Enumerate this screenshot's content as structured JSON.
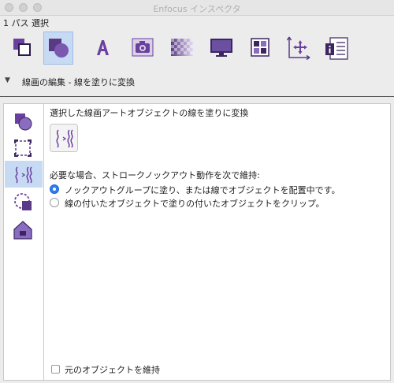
{
  "window": {
    "title": "Enfocus インスペクタ"
  },
  "selection": {
    "info": "1 パス 選択"
  },
  "toolbar": {
    "tabs": [
      {
        "icon": "path-object-icon",
        "active": false
      },
      {
        "icon": "shape-fill-icon",
        "active": true
      },
      {
        "icon": "text-icon",
        "active": false
      },
      {
        "icon": "image-icon",
        "active": false
      },
      {
        "icon": "transparency-icon",
        "active": false
      },
      {
        "icon": "display-icon",
        "active": false
      },
      {
        "icon": "grid-icon",
        "active": false
      },
      {
        "icon": "move-axes-icon",
        "active": false
      },
      {
        "icon": "info-list-icon",
        "active": false
      }
    ]
  },
  "section": {
    "title": "線画の編集 - 線を塗りに変換"
  },
  "sidebar": {
    "items": [
      {
        "icon": "shape-edit-icon",
        "active": false
      },
      {
        "icon": "bounding-box-icon",
        "active": false
      },
      {
        "icon": "stroke-to-fill-icon",
        "active": true
      },
      {
        "icon": "dashed-shape-icon",
        "active": false
      },
      {
        "icon": "house-shape-icon",
        "active": false
      }
    ]
  },
  "main": {
    "heading": "選択した線画アートオブジェクトの線を塗りに変換",
    "knockout_label": "必要な場合、ストロークノックアウト動作を次で維持:",
    "options": [
      {
        "label": "ノックアウトグループに塗り、または線でオブジェクトを配置中です。",
        "selected": true
      },
      {
        "label": "線の付いたオブジェクトで塗りの付いたオブジェクトをクリップ。",
        "selected": false
      }
    ],
    "keep_original_label": "元のオブジェクトを維持",
    "keep_original_checked": false
  },
  "colors": {
    "accent": "#2f7bf0",
    "icon_purple": "#6b3fa0",
    "tab_highlight": "#c7daf3"
  }
}
